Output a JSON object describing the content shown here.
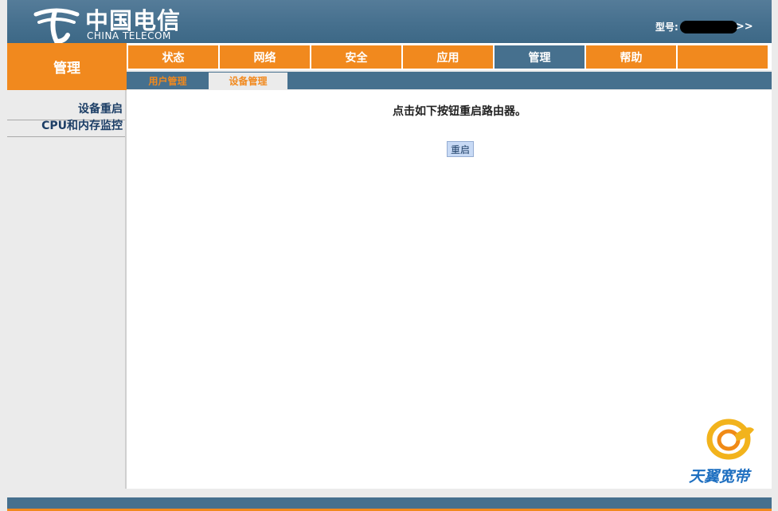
{
  "header": {
    "logo_cn": "中国电信",
    "logo_en": "CHINA TELECOM",
    "model_label": "型号:",
    "model_arrow": ">>"
  },
  "section_title": "管理",
  "main_nav": [
    {
      "label": "状态",
      "active": false
    },
    {
      "label": "网络",
      "active": false
    },
    {
      "label": "安全",
      "active": false
    },
    {
      "label": "应用",
      "active": false
    },
    {
      "label": "管理",
      "active": true
    },
    {
      "label": "帮助",
      "active": false
    },
    {
      "label": "",
      "active": false
    }
  ],
  "sub_nav": [
    {
      "label": "用户管理",
      "active": false
    },
    {
      "label": "设备管理",
      "active": true
    }
  ],
  "sidebar": {
    "items": [
      {
        "label": "设备重启"
      },
      {
        "label": "CPU和内存监控"
      }
    ]
  },
  "content": {
    "instruction": "点击如下按钮重启路由器。",
    "reboot_button": "重启"
  },
  "brand": {
    "text": "天翼宽带"
  },
  "colors": {
    "header_blue": "#46708e",
    "accent_orange": "#f1891e",
    "sidebar_bg": "#ebebeb",
    "link_navy": "#1c3e66",
    "button_bg": "#c8daf5"
  },
  "icons": {
    "logo": "china-telecom-logo-icon",
    "brand": "tianyi-broadband-logo-icon"
  }
}
